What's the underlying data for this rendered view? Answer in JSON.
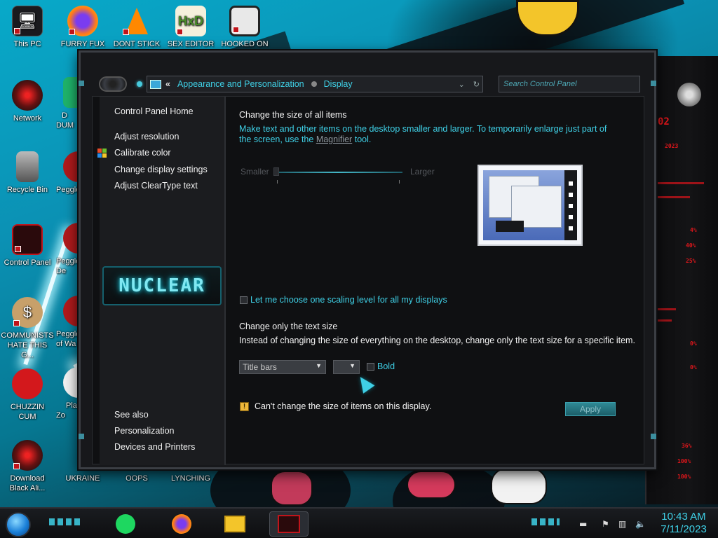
{
  "desktop": {
    "icons_left": [
      {
        "label": "This PC",
        "icon": "computer-icon"
      },
      {
        "label": "Network",
        "icon": "network-icon"
      },
      {
        "label": "Recycle Bin",
        "icon": "recycle-bin-icon"
      },
      {
        "label": "Control Panel",
        "icon": "control-panel-icon"
      },
      {
        "label": "COMMUNISTS HATE THIS G...",
        "icon": "money-bag-icon"
      },
      {
        "label": "CHUZZIN CUM",
        "icon": "chuzzle-icon"
      },
      {
        "label": "Download Black Ali...",
        "icon": "alien-icon"
      }
    ],
    "icons_top": [
      {
        "label": "FURRY FUX",
        "icon": "firefox-icon"
      },
      {
        "label": "DONT STICK",
        "icon": "vlc-icon"
      },
      {
        "label": "SEX EDITOR",
        "icon": "hxd-icon"
      },
      {
        "label": "HOOKED ON",
        "icon": "game-icon"
      }
    ],
    "icons_col2_partial": [
      {
        "label": "D DUM",
        "icon": "app-icon"
      },
      {
        "label": "Peggle",
        "icon": "peggle-icon"
      },
      {
        "label": "Peggle De",
        "icon": "peggle-icon"
      },
      {
        "label": "Peggle of Wa",
        "icon": "peggle-icon"
      },
      {
        "label": "Plan Zo",
        "icon": "flower-icon"
      }
    ],
    "icons_bottom": [
      {
        "label": "UKRAINE",
        "icon": "shortcut-icon"
      },
      {
        "label": "OOPS",
        "icon": "shortcut-icon"
      },
      {
        "label": "LYNCHING",
        "icon": "shortcut-icon"
      }
    ],
    "hud_numbers": [
      "02",
      "4%",
      "40%",
      "25%",
      "0%",
      "0%",
      "36%",
      "100%",
      "100%"
    ],
    "hud_year": "2023"
  },
  "window": {
    "address": {
      "chevron": "«",
      "crumbs": [
        "Appearance and Personalization",
        "Display"
      ],
      "dropdown_glyph": "⌄",
      "refresh_glyph": "↻"
    },
    "search": {
      "placeholder": "Search Control Panel"
    },
    "close_glyph": "×",
    "sidebar": {
      "home": "Control Panel Home",
      "links": [
        "Adjust resolution",
        "Calibrate color",
        "Change display settings",
        "Adjust ClearType text"
      ],
      "logo_text": "NUCLEAR",
      "see_also_title": "See also",
      "see_also": [
        "Personalization",
        "Devices and Printers"
      ]
    },
    "main": {
      "title": "Change the size of all items",
      "description": "Make text and other items on the desktop smaller and larger. To temporarily enlarge just part of the screen, use the",
      "magnifier_link": "Magnifier",
      "description_tail": "tool.",
      "slider": {
        "min_label": "Smaller",
        "max_label": "Larger",
        "value": 0.0
      },
      "scaling_checkbox": {
        "label": "Let me choose one scaling level for all my displays",
        "checked": false
      },
      "text_size_title": "Change only the text size",
      "text_size_desc": "Instead of changing the size of everything on the desktop, change only the text size for a specific item.",
      "item_select": {
        "value": "Title bars"
      },
      "size_select": {
        "value": ""
      },
      "bold_checkbox": {
        "label": "Bold",
        "checked": false
      },
      "warning": "Can't change the size of items on this display.",
      "apply_label": "Apply"
    }
  },
  "taskbar": {
    "pinned": [
      "spotify-icon",
      "firefox-icon",
      "file-explorer-icon",
      "control-panel-icon"
    ],
    "active_index": 3,
    "tray": [
      "flag-icon",
      "network-icon",
      "volume-icon"
    ],
    "time": "10:43 AM",
    "date": "7/11/2023"
  },
  "colors": {
    "accent": "#3fd0e6",
    "warning": "#f0b93a",
    "hud_red": "#e0161b"
  }
}
